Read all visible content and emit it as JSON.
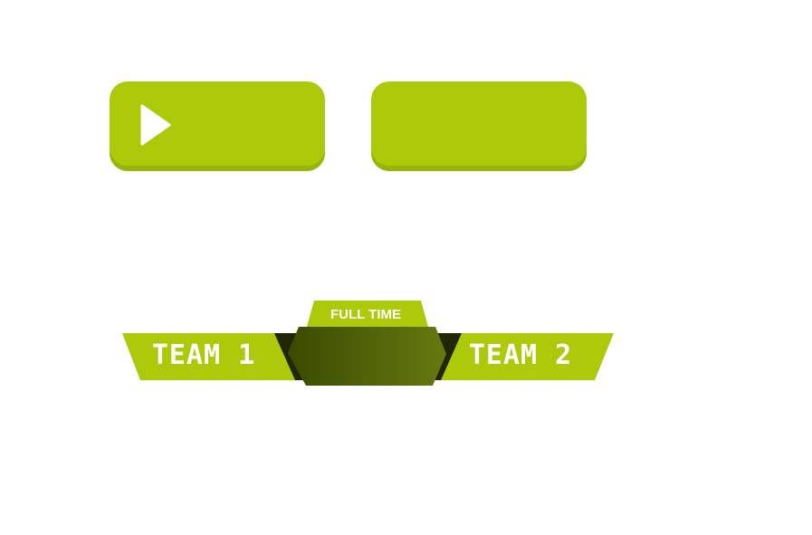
{
  "buttons": [
    {
      "name": "play-button",
      "icon": "play-icon",
      "label": ""
    },
    {
      "name": "blank-button",
      "icon": "",
      "label": ""
    }
  ],
  "scoreboard": {
    "status": "FULL TIME",
    "team_left": "TEAM 1",
    "team_right": "TEAM 2",
    "score": ""
  },
  "colors": {
    "accent": "#acca0a",
    "accent_shadow": "#9ab50a",
    "dark_panel_start": "#3a4a00",
    "dark_panel_end": "#66790f",
    "dark_wing": "#1f2706",
    "text": "#ffffff"
  }
}
